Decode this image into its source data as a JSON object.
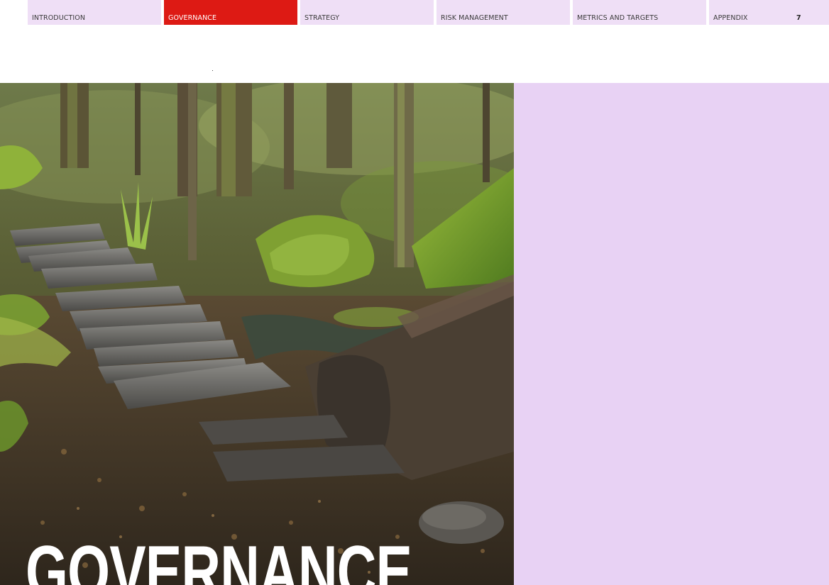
{
  "nav": {
    "tabs": [
      {
        "label": "INTRODUCTION",
        "active": false
      },
      {
        "label": "GOVERNANCE",
        "active": true
      },
      {
        "label": "STRATEGY",
        "active": false
      },
      {
        "label": "RISK MANAGEMENT",
        "active": false
      },
      {
        "label": "METRICS AND TARGETS",
        "active": false
      },
      {
        "label": "APPENDIX",
        "active": false
      }
    ],
    "page_number": "7"
  },
  "hero": {
    "title": "GOVERNANCE",
    "image": "forest-boardwalk-photo"
  },
  "colors": {
    "tab_background": "#efdff6",
    "tab_active": "#dd1a14",
    "side_panel": "#e8d2f4",
    "title_text": "#ffffff"
  }
}
